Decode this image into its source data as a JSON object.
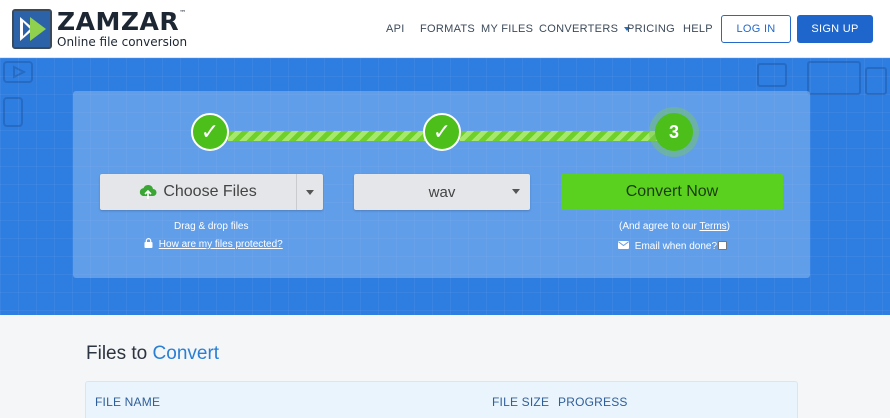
{
  "brand": {
    "name": "ZAMZAR",
    "trademark": "™",
    "tagline": "Online file conversion"
  },
  "nav": {
    "items": [
      "API",
      "FORMATS",
      "MY FILES",
      "CONVERTERS",
      "PRICING",
      "HELP"
    ],
    "login": "LOG IN",
    "signup": "SIGN UP"
  },
  "steps": [
    "✓",
    "✓",
    "3"
  ],
  "upload": {
    "choose_label": "Choose Files",
    "drag_drop": "Drag & drop files",
    "protected_link": "How are my files protected?"
  },
  "format": {
    "selected": "wav"
  },
  "convert": {
    "label": "Convert Now",
    "agree_prefix": "(And agree to our ",
    "terms_link": "Terms",
    "agree_suffix": ")",
    "email_label": "Email when done?"
  },
  "files": {
    "title_prefix": "Files to ",
    "title_accent": "Convert",
    "columns": [
      "FILE NAME",
      "FILE SIZE",
      "PROGRESS"
    ]
  },
  "colors": {
    "accent": "#1f66cc",
    "hero": "#2e7de1",
    "success": "#5bd11f",
    "step": "#4cbf1a"
  }
}
